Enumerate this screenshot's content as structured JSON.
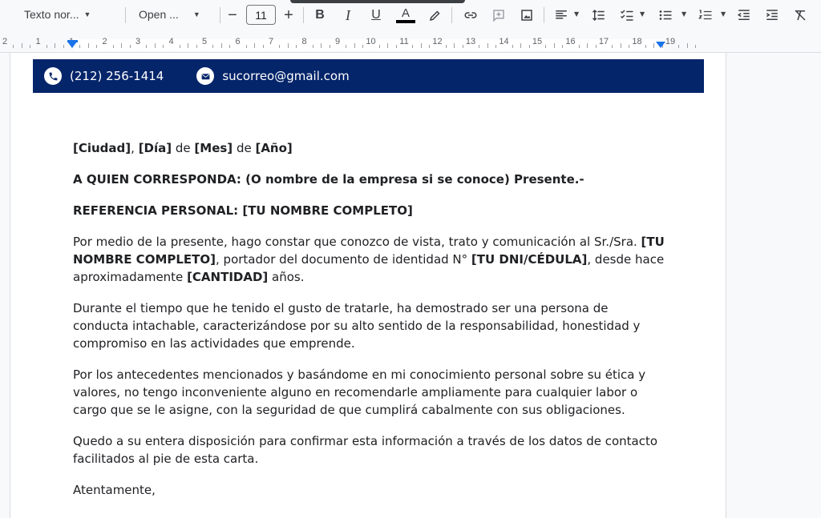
{
  "toolbar": {
    "style_label": "Texto nor...",
    "font_label": "Open ...",
    "font_size": "11",
    "minus": "−",
    "plus": "+",
    "bold": "B",
    "italic": "I",
    "underline": "U",
    "text_color_letter": "A",
    "colors": {
      "text_color_bar": "#000000",
      "brand_blue": "#1a73e8"
    },
    "icons": [
      "highlighter-icon",
      "link-icon",
      "comment-icon",
      "image-icon",
      "align-left-icon",
      "line-spacing-icon",
      "checklist-icon",
      "bulleted-list-icon",
      "numbered-list-icon",
      "decrease-indent-icon",
      "increase-indent-icon",
      "clear-formatting-icon"
    ]
  },
  "ruler": {
    "numbers": [
      "2",
      "1",
      "1",
      "2",
      "3",
      "4",
      "5",
      "6",
      "7",
      "8",
      "9",
      "10",
      "11",
      "12",
      "13",
      "14",
      "15",
      "16",
      "17",
      "18",
      "19"
    ]
  },
  "header": {
    "phone": "(212) 256-1414",
    "email": "sucorreo@gmail.com",
    "bar_color": "#04256a"
  },
  "letter": {
    "date": {
      "city": "[Ciudad]",
      "sep1": ", ",
      "day": "[Día]",
      "de1": " de ",
      "month": "[Mes]",
      "de2": " de ",
      "year": "[Año]"
    },
    "salutation": "A QUIEN CORRESPONDA: (O nombre de la empresa si se conoce) Presente.-",
    "reference": "REFERENCIA PERSONAL: [TU NOMBRE COMPLETO]",
    "p1": {
      "a": "Por medio de la presente, hago constar que conozco de vista, trato y comunicación al Sr./Sra. ",
      "name": "[TU NOMBRE COMPLETO]",
      "b": ", portador del documento de identidad N° ",
      "id": "[TU DNI/CÉDULA]",
      "c": ", desde hace aproximadamente ",
      "qty": "[CANTIDAD]",
      "d": " años."
    },
    "p2": "Durante el tiempo que he tenido el gusto de tratarle, ha demostrado ser una persona de conducta intachable, caracterizándose por su alto sentido de la responsabilidad, honestidad y compromiso en las actividades que emprende.",
    "p3": "Por los antecedentes mencionados y basándome en mi conocimiento personal sobre su ética y valores, no tengo inconveniente alguno en recomendarle ampliamente para cualquier labor o cargo que se le asigne, con la seguridad de que cumplirá cabalmente con sus obligaciones.",
    "p4": "Quedo a su entera disposición para confirmar esta información a través de los datos de contacto facilitados al pie de esta carta.",
    "closing": "Atentamente,"
  }
}
